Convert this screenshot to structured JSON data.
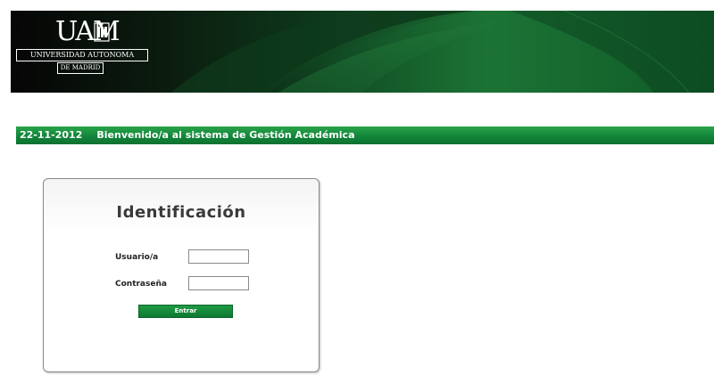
{
  "header": {
    "logo_mark": "UAM",
    "university_name": "UNIVERSIDAD AUTONOMA",
    "university_city": "DE MADRID"
  },
  "welcome_bar": {
    "date": "22-11-2012",
    "message": "Bienvenido/a al sistema de Gestión Académica"
  },
  "login": {
    "title": "Identificación",
    "username_label": "Usuario/a",
    "username_value": "",
    "password_label": "Contraseña",
    "password_value": "",
    "submit_label": "Entrar"
  },
  "colors": {
    "brand_green": "#12853a",
    "header_dark": "#050505"
  }
}
